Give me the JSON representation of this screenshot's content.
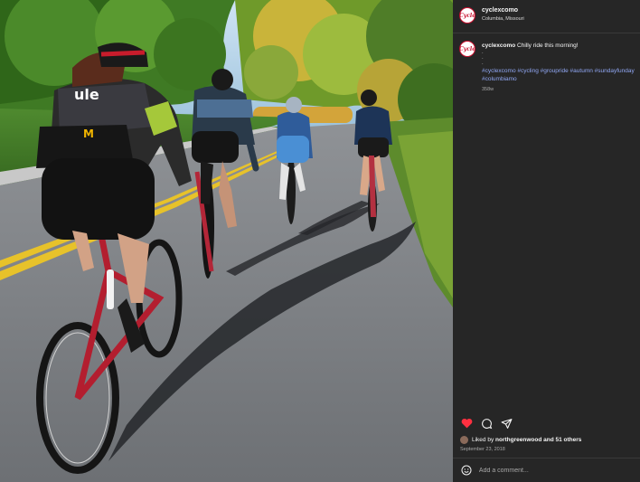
{
  "post": {
    "username": "cyclexcomo",
    "location": "Columbia, Missouri",
    "avatar_text": "Cycle",
    "caption_text": "Chilly ride this morning!",
    "caption_dots": [
      ".",
      ".",
      "."
    ],
    "hashtags": "#cyclexcomo #cycling #groupride #autumn #sundayfunday #columbiamo",
    "time_ago": "358w",
    "likes": {
      "liked_by_prefix": "Liked by",
      "liked_by_user": "northgreenwood",
      "others_text": "and 51 others"
    },
    "date": "September 23, 2018",
    "comment_placeholder": "Add a comment...",
    "photo_alt": "Five cyclists riding on a sunny road"
  },
  "icons": {
    "like": "heart-icon",
    "comment": "comment-icon",
    "share": "share-icon",
    "emoji": "emoji-icon"
  },
  "colors": {
    "like_red": "#ff3040",
    "hashtag_blue": "#91a8f5",
    "panel_bg": "#262626"
  }
}
